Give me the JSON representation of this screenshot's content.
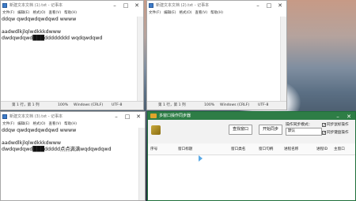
{
  "notepad_top_left": {
    "title": "新建文本文档 (1).txt - 记事本",
    "menu": [
      "文件(F)",
      "编辑(E)",
      "格式(O)",
      "查看(V)",
      "帮助(H)"
    ],
    "lines": [
      "ddqw qwdqwdqwdqwd wwww",
      "",
      "aadwdlkjlqlwdkkkdwww",
      "dwdqwdqwd███dddddddd wqdqwdqwd"
    ],
    "status": {
      "position": "第 1 行，第 1 列",
      "zoom": "100%",
      "eol": "Windows (CRLF)",
      "encoding": "UTF-8"
    }
  },
  "notepad_top_right": {
    "title": "新建文本文档 (2).txt - 记事本",
    "menu": [
      "文件(F)",
      "编辑(E)",
      "格式(O)",
      "查看(V)",
      "帮助(H)"
    ],
    "status": {
      "position": "第 1 行，第 1 列",
      "zoom": "100%",
      "eol": "Windows (CRLF)",
      "encoding": "UTF-8"
    }
  },
  "notepad_bottom_left": {
    "title": "新建文本文档 (3).txt - 记事本",
    "menu": [
      "文件(F)",
      "编辑(E)",
      "格式(O)",
      "查看(V)",
      "帮助(H)"
    ],
    "lines": [
      "ddqw qwdqwdqwdqwd wwww",
      "",
      "aadwdlkjlqlwdkkkdwww",
      "dwdqwdqwd███ddddd点点满满wqdqwdqwd"
    ]
  },
  "sync_tool": {
    "title": "多窗口操作同步器",
    "buttons": {
      "find_window": "查找窗口",
      "start_sync": "开始同步"
    },
    "sync_mode_label": "操作同步模式：",
    "sync_mode_value": "默认",
    "checkboxes": [
      {
        "label": "同步鼠标操作",
        "checked": true
      },
      {
        "label": "同步键盘操作",
        "checked": true
      }
    ],
    "columns": [
      "序号",
      "窗口标题",
      "窗口类名",
      "窗口句柄",
      "进程名称",
      "进程ID",
      "主窗口"
    ]
  },
  "colors": {
    "sync_titlebar": "#2e7d46",
    "notepad_icon": "#3d7cc9"
  }
}
